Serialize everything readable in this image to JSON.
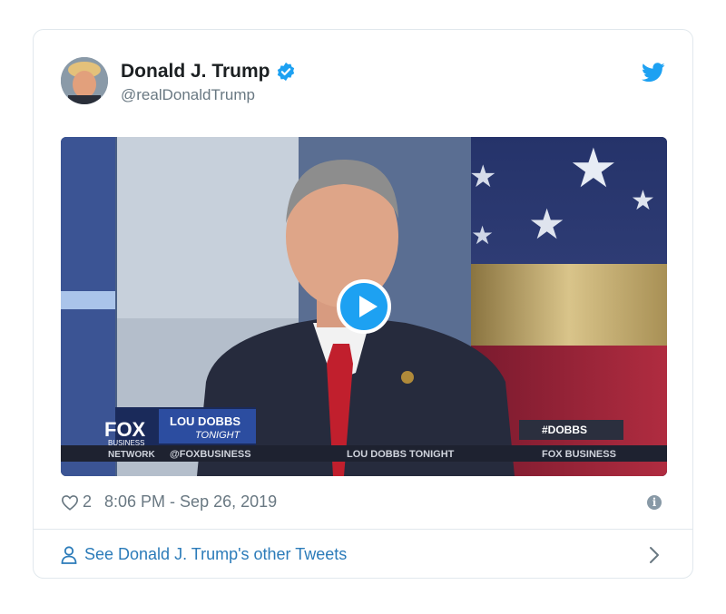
{
  "tweet": {
    "author_name": "Donald J. Trump",
    "author_handle": "@realDonaldTrump",
    "like_count": "2",
    "timestamp": "8:06 PM - Sep 26, 2019",
    "other_tweets_link": "See Donald J. Trump's other Tweets"
  },
  "media": {
    "lower_third_show": "LOU DOBBS",
    "lower_third_sub": "TONIGHT",
    "network_logo": "FOX",
    "network_sub": "BUSINESS",
    "network_label": "NETWORK",
    "ticker_handle": "@FOXBUSINESS",
    "ticker_show": "LOU DOBBS TONIGHT",
    "ticker_network": "FOX BUSINESS",
    "hashtag": "#DOBBS"
  },
  "icons": {
    "verified": "verified-badge-icon",
    "twitter": "twitter-bird-icon",
    "play": "play-icon",
    "heart": "heart-icon",
    "info": "info-icon",
    "person": "person-icon",
    "chevron": "chevron-right-icon"
  },
  "colors": {
    "accent": "#1da1f2",
    "link": "#2b7bb9",
    "meta_text": "#697882",
    "name_text": "#1c2022",
    "border": "#e1e8ed"
  }
}
